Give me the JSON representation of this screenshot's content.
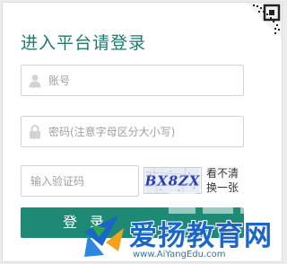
{
  "login": {
    "title": "进入平台请登录",
    "username_placeholder": "账号",
    "password_placeholder": "密码(注意字母区分大小写)",
    "captcha_placeholder": "输入验证码",
    "captcha_text": "BX8ZX",
    "refresh_label": "看不清换一张",
    "login_button": "登录"
  },
  "watermark": {
    "text": "爱扬教育网",
    "url": "www.AiYangEdu.com"
  },
  "icons": {
    "corner": "qr-code-icon",
    "username": "user-icon",
    "password": "lock-icon"
  },
  "colors": {
    "title": "#1f7a70",
    "button": "#1e8a76",
    "watermark": "#1b66c9"
  }
}
